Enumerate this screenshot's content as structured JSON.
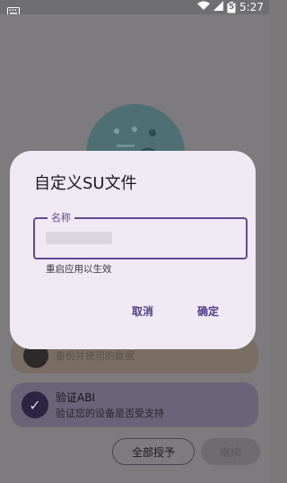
{
  "status_bar": {
    "time": "5:27",
    "battery_level": "5",
    "icons": [
      "keyboard-icon",
      "wifi-icon",
      "signal-icon",
      "battery-icon"
    ]
  },
  "background": {
    "card_1": {
      "text": "备份并使用的数据"
    },
    "card_2": {
      "title": "验证ABI",
      "subtitle": "验证您的设备是否受支持"
    },
    "buttons": {
      "grant_all": "全部授予",
      "continue": "继续"
    }
  },
  "dialog": {
    "title": "自定义SU文件",
    "field": {
      "label": "名称",
      "value": ""
    },
    "helper": "重启应用以生效",
    "cancel": "取消",
    "confirm": "确定"
  },
  "colors": {
    "accent": "#5e4b90",
    "dialog_bg": "#efe9f4",
    "scrim": "#7a7878"
  }
}
